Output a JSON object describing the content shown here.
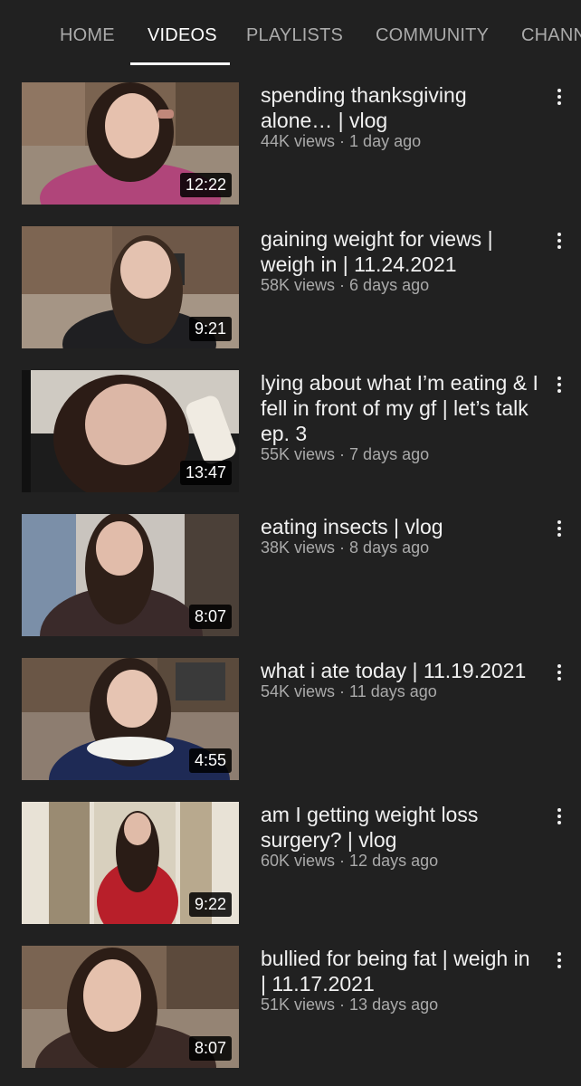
{
  "tabs": [
    "HOME",
    "VIDEOS",
    "PLAYLISTS",
    "COMMUNITY",
    "CHANN"
  ],
  "active_tab": "VIDEOS",
  "videos": [
    {
      "title": "spending thanksgiving alone… | vlog",
      "views": "44K views",
      "age": "1 day ago",
      "duration": "12:22"
    },
    {
      "title": "gaining weight for views | weigh in | 11.24.2021",
      "views": "58K views",
      "age": "6 days ago",
      "duration": "9:21"
    },
    {
      "title": "lying about what I’m eating & I fell in front of my gf | let’s talk ep. 3",
      "views": "55K views",
      "age": "7 days ago",
      "duration": "13:47"
    },
    {
      "title": "eating insects | vlog",
      "views": "38K views",
      "age": "8 days ago",
      "duration": "8:07"
    },
    {
      "title": "what i ate today | 11.19.2021",
      "views": "54K views",
      "age": "11 days ago",
      "duration": "4:55"
    },
    {
      "title": "am I getting weight loss surgery? | vlog",
      "views": "60K views",
      "age": "12 days ago",
      "duration": "9:22"
    },
    {
      "title": "bullied for being fat | weigh in | 11.17.2021",
      "views": "51K views",
      "age": "13 days ago",
      "duration": "8:07"
    }
  ],
  "meta_separator": " · ",
  "icons": {
    "menu": "more-vert-icon"
  }
}
